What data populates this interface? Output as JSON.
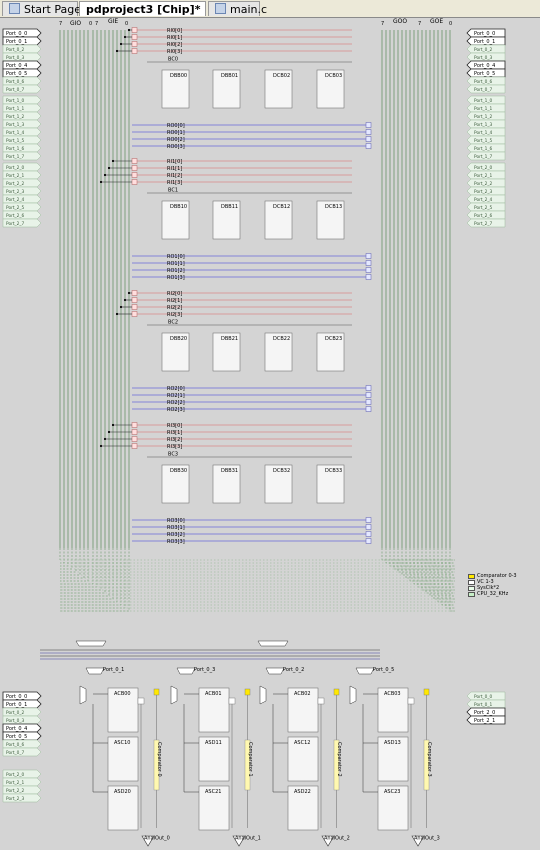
{
  "tabs": [
    {
      "label": "Start Page",
      "active": false
    },
    {
      "label": "pdproject3 [Chip]*",
      "active": true
    },
    {
      "label": "main.c",
      "active": false
    }
  ],
  "global_bus": {
    "gio": "GIO",
    "gie": "GIE",
    "goo": "GOO",
    "goe": "GOE",
    "gio_hi": "7",
    "gio_lo": "0",
    "gie_hi": "7",
    "gie_lo": "0",
    "goo_hi": "7",
    "goe_hi": "7",
    "goe_lo": "0"
  },
  "left_ports": [
    "Port_0_0",
    "Port_0_1",
    "Port_0_2",
    "Port_0_3",
    "Port_0_4",
    "Port_0_5",
    "Port_0_6",
    "Port_0_7",
    "Port_1_0",
    "Port_1_1",
    "Port_1_2",
    "Port_1_3",
    "Port_1_4",
    "Port_1_5",
    "Port_1_6",
    "Port_1_7",
    "Port_2_0",
    "Port_2_1",
    "Port_2_2",
    "Port_2_3",
    "Port_2_4",
    "Port_2_5",
    "Port_2_6",
    "Port_2_7"
  ],
  "right_ports": [
    "Port_0_0",
    "Port_0_1",
    "Port_0_2",
    "Port_0_3",
    "Port_0_4",
    "Port_0_5",
    "Port_0_6",
    "Port_0_7",
    "Port_1_0",
    "Port_1_1",
    "Port_1_2",
    "Port_1_3",
    "Port_1_4",
    "Port_1_5",
    "Port_1_6",
    "Port_1_7",
    "Port_2_0",
    "Port_2_1",
    "Port_2_2",
    "Port_2_3",
    "Port_2_4",
    "Port_2_5",
    "Port_2_6",
    "Port_2_7"
  ],
  "active_left": [
    0,
    1,
    4,
    5
  ],
  "active_right": [
    0,
    1,
    4,
    5
  ],
  "rows": [
    {
      "ri": [
        "RI0[0]",
        "RI0[1]",
        "RI0[2]",
        "RI0[3]"
      ],
      "bc": "BC0",
      "blocks": [
        "DBB00",
        "DBB01",
        "DCB02",
        "DCB03"
      ],
      "ro": [
        "RO0[0]",
        "RO0[1]",
        "RO0[2]",
        "RO0[3]"
      ]
    },
    {
      "ri": [
        "RI1[0]",
        "RI1[1]",
        "RI1[2]",
        "RI1[3]"
      ],
      "bc": "BC1",
      "blocks": [
        "DBB10",
        "DBB11",
        "DCB12",
        "DCB13"
      ],
      "ro": [
        "RO1[0]",
        "RO1[1]",
        "RO1[2]",
        "RO1[3]"
      ]
    },
    {
      "ri": [
        "RI2[0]",
        "RI2[1]",
        "RI2[2]",
        "RI2[3]"
      ],
      "bc": "BC2",
      "blocks": [
        "DBB20",
        "DBB21",
        "DCB22",
        "DCB23"
      ],
      "ro": [
        "RO2[0]",
        "RO2[1]",
        "RO2[2]",
        "RO2[3]"
      ]
    },
    {
      "ri": [
        "RI3[0]",
        "RI3[1]",
        "RI3[2]",
        "RI3[3]"
      ],
      "bc": "BC3",
      "blocks": [
        "DBB30",
        "DBB31",
        "DCB32",
        "DCB33"
      ],
      "ro": [
        "RO3[0]",
        "RO3[1]",
        "RO3[2]",
        "RO3[3]"
      ]
    }
  ],
  "legend": [
    {
      "label": "Comparator 0-3",
      "color": "#ffe800"
    },
    {
      "label": "VC 1-3",
      "color": "#ffffff"
    },
    {
      "label": "SysClk*2",
      "color": "#e8fbe8"
    },
    {
      "label": "CPU_32_KHz",
      "color": "#c8f0c8"
    }
  ],
  "analog": {
    "columns": [
      {
        "blocks": [
          "ACB00",
          "ASC10",
          "ASD20"
        ],
        "comparator": "Comparator 0",
        "mux": "Port_0_1"
      },
      {
        "blocks": [
          "ACB01",
          "ASD11",
          "ASC21"
        ],
        "comparator": "Comparator 1",
        "mux": "Port_0_3"
      },
      {
        "blocks": [
          "ACB02",
          "ASC12",
          "ASD22"
        ],
        "comparator": "Comparator 2",
        "mux": "Port_0_2"
      },
      {
        "blocks": [
          "ACB03",
          "ASD13",
          "ASC23"
        ],
        "comparator": "Comparator 3",
        "mux": "Port_0_5"
      }
    ],
    "left_ports": [
      "Port_0_0",
      "Port_0_1",
      "Port_0_2",
      "Port_0_3",
      "Port_0_4",
      "Port_0_5",
      "Port_0_6",
      "Port_0_7",
      "Port_2_0",
      "Port_2_1",
      "Port_2_2",
      "Port_2_3"
    ],
    "right_ports": [
      "Port_0_0",
      "Port_0_1",
      "Port_2_0",
      "Port_2_1"
    ],
    "buf_labels": [
      "AnalOut_0",
      "AnalOut_1",
      "AnalOut_2",
      "AnalOut_3"
    ]
  }
}
